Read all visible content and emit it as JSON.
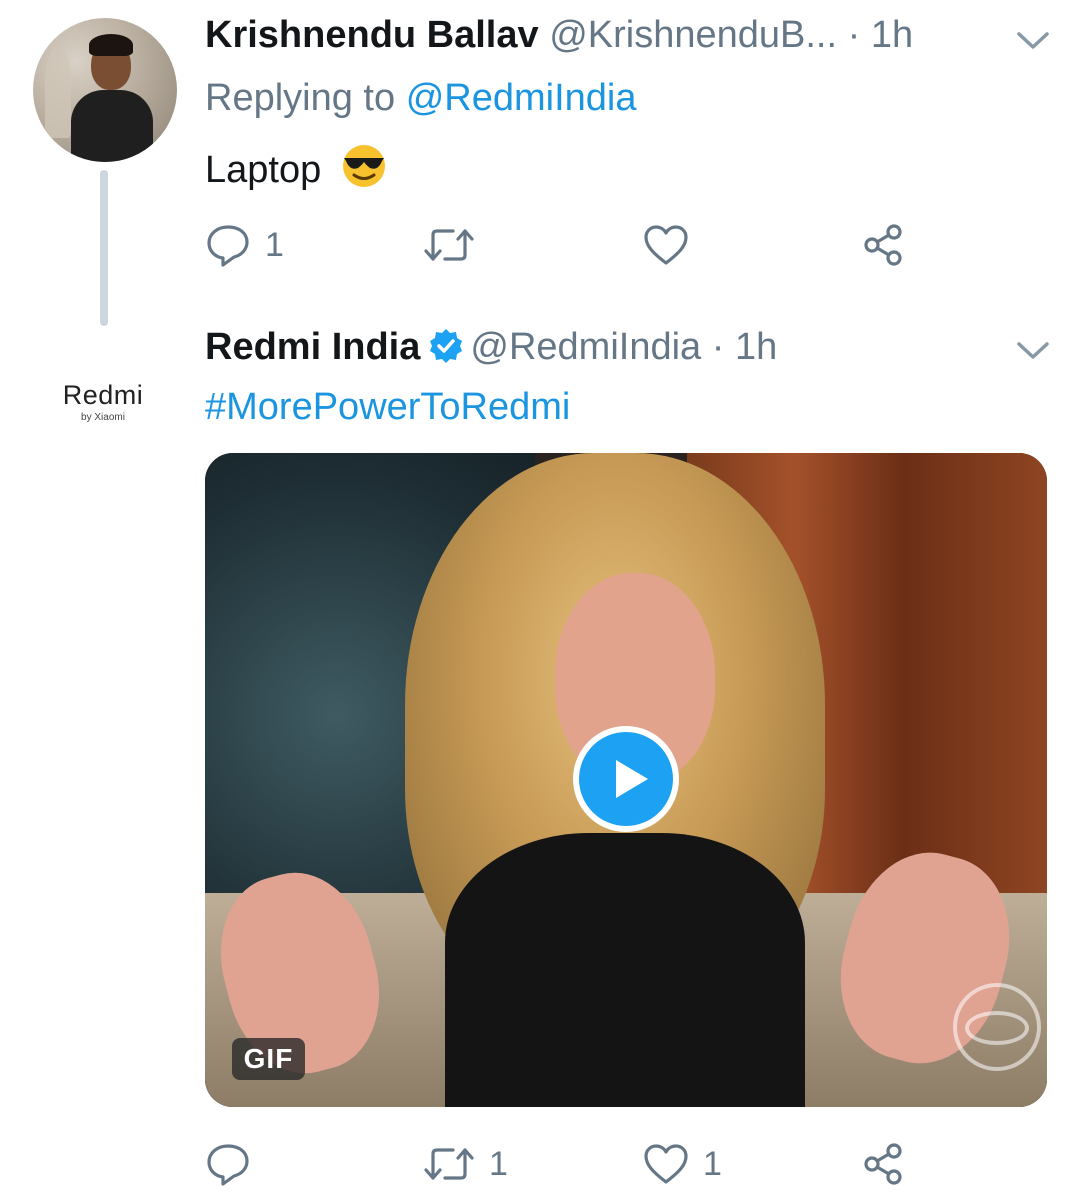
{
  "tweets": [
    {
      "display_name": "Krishnendu Ballav",
      "handle": "@KrishnenduB...",
      "time": "· 1h",
      "replying_prefix": "Replying to",
      "replying_handle": "@RedmiIndia",
      "text": "Laptop",
      "emoji": "😎",
      "actions": {
        "reply_count": "1",
        "retweet_count": "",
        "like_count": ""
      }
    },
    {
      "display_name": "Redmi India",
      "handle": "@RedmiIndia",
      "time": "· 1h",
      "text": "#MorePowerToRedmi",
      "avatar_logo": {
        "word": "Redmi",
        "sub": "by Xiaomi"
      },
      "media": {
        "badge": "GIF"
      },
      "actions": {
        "reply_count": "",
        "retweet_count": "1",
        "like_count": "1"
      }
    }
  ],
  "colors": {
    "link": "#1b95e0",
    "muted": "#657786",
    "verified": "#1da1f2"
  },
  "icons": [
    "reply-icon",
    "retweet-icon",
    "like-icon",
    "share-icon",
    "chevron-down-icon",
    "verified-badge-icon",
    "play-icon"
  ]
}
